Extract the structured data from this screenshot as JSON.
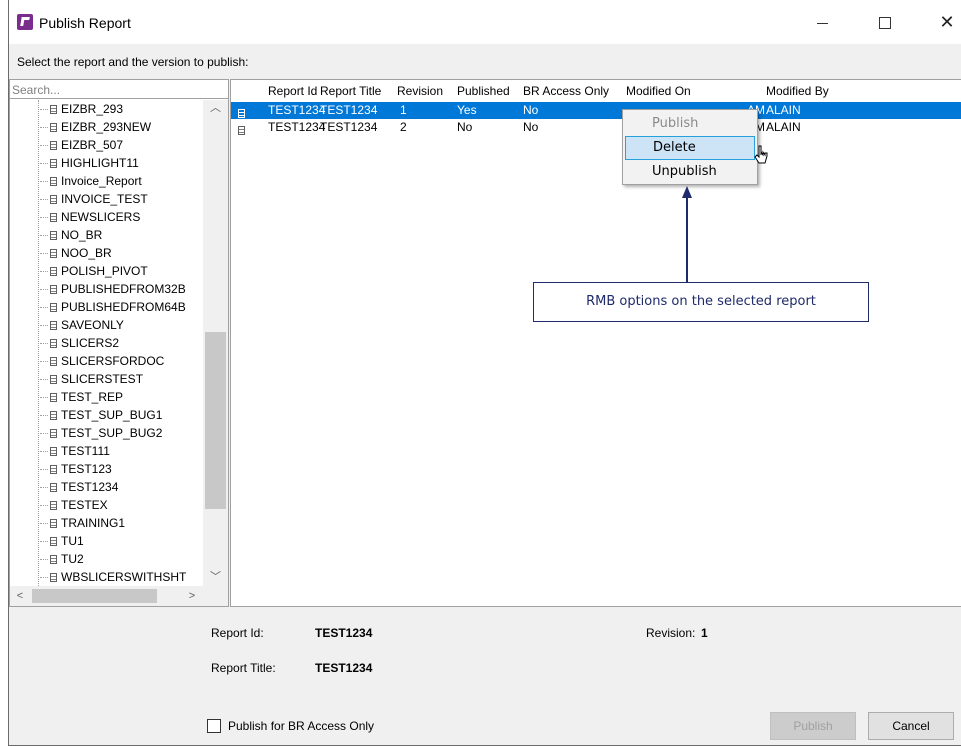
{
  "window": {
    "title": "Publish Report"
  },
  "instructions": "Select the report and the version to publish:",
  "search": {
    "placeholder": "Search..."
  },
  "tree": {
    "items": [
      "EIZBR_293",
      "EIZBR_293NEW",
      "EIZBR_507",
      "HIGHLIGHT11",
      "Invoice_Report",
      "INVOICE_TEST",
      "NEWSLICERS",
      "NO_BR",
      "NOO_BR",
      "POLISH_PIVOT",
      "PUBLISHEDFROM32B",
      "PUBLISHEDFROM64B",
      "SAVEONLY",
      "SLICERS2",
      "SLICERSFORDOC",
      "SLICERSTEST",
      "TEST_REP",
      "TEST_SUP_BUG1",
      "TEST_SUP_BUG2",
      "TEST111",
      "TEST123",
      "TEST1234",
      "TESTEX",
      "TRAINING1",
      "TU1",
      "TU2",
      "WBSLICERSWITHSHT"
    ]
  },
  "grid": {
    "columns": [
      "Report Id",
      "Report Title",
      "Revision",
      "Published",
      "BR Access Only",
      "Modified On",
      "Modified By"
    ],
    "rows": [
      {
        "report_id": "TEST1234",
        "report_title": "TEST1234",
        "revision": "1",
        "published": "Yes",
        "br_access_only": "No",
        "modified_on": "AM",
        "modified_by": "ALAIN",
        "selected": true
      },
      {
        "report_id": "TEST1234",
        "report_title": "TEST1234",
        "revision": "2",
        "published": "No",
        "br_access_only": "No",
        "modified_on": "PM",
        "modified_by": "ALAIN",
        "selected": false
      }
    ]
  },
  "context_menu": {
    "items": [
      {
        "label": "Publish",
        "state": "disabled"
      },
      {
        "label": "Delete",
        "state": "hover"
      },
      {
        "label": "Unpublish",
        "state": "normal"
      }
    ]
  },
  "callout": {
    "text": "RMB options on the selected report",
    "color": "#1f2a6b"
  },
  "details": {
    "report_id_label": "Report Id:",
    "report_id_value": "TEST1234",
    "report_title_label": "Report Title:",
    "report_title_value": "TEST1234",
    "revision_label": "Revision:",
    "revision_value": "1"
  },
  "br_access_checkbox": {
    "label": "Publish for BR Access Only",
    "checked": false
  },
  "buttons": {
    "publish": "Publish",
    "cancel": "Cancel"
  },
  "colors": {
    "selection": "#0078d7",
    "window_bg": "#f0f0f0",
    "app_icon": "#7b2d8e"
  }
}
